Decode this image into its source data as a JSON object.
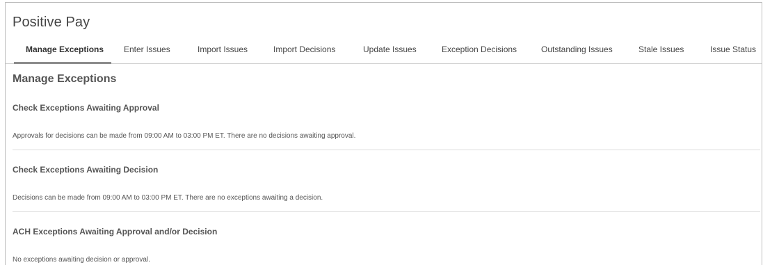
{
  "app": {
    "title": "Positive Pay"
  },
  "tabs": [
    {
      "label": "Manage Exceptions"
    },
    {
      "label": "Enter Issues"
    },
    {
      "label": "Import Issues"
    },
    {
      "label": "Import Decisions"
    },
    {
      "label": "Update Issues"
    },
    {
      "label": "Exception Decisions"
    },
    {
      "label": "Outstanding Issues"
    },
    {
      "label": "Stale Issues"
    },
    {
      "label": "Issue Status"
    }
  ],
  "active_tab": "Manage Exceptions",
  "main": {
    "title": "Manage Exceptions",
    "sections": [
      {
        "heading": "Check Exceptions Awaiting Approval",
        "text": "Approvals for decisions can be made from 09:00 AM to 03:00 PM ET. There are no decisions awaiting approval."
      },
      {
        "heading": "Check Exceptions Awaiting Decision",
        "text": "Decisions can be made from 09:00 AM to 03:00 PM ET. There are no exceptions awaiting a decision."
      },
      {
        "heading": "ACH Exceptions Awaiting Approval and/or Decision",
        "text": "No exceptions awaiting decision or approval."
      }
    ]
  },
  "colors": {
    "active_tab_indicator": "#8c8c8c",
    "divider": "#dcdcdc",
    "frame_border": "#bdbdbd"
  }
}
